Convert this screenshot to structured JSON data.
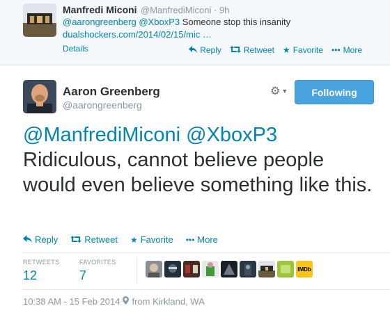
{
  "parent_tweet": {
    "name": "Manfredi Miconi",
    "handle": "@ManfrediMiconi",
    "separator": "·",
    "time": "9h",
    "mention1": "@aarongreenberg",
    "mention2": "@XboxP3",
    "text": "Someone stop this insanity",
    "link": "dualshockers.com/2014/02/15/mic",
    "ellipsis": "…",
    "details": "Details",
    "actions": {
      "reply": "Reply",
      "retweet": "Retweet",
      "favorite": "Favorite",
      "more": "More"
    }
  },
  "main_tweet": {
    "name": "Aaron Greenberg",
    "handle": "@aarongreenberg",
    "follow_label": "Following",
    "mention1": "@ManfrediMiconi",
    "mention2": "@XboxP3",
    "text": "Ridiculous, cannot believe people would even believe something like this.",
    "actions": {
      "reply": "Reply",
      "retweet": "Retweet",
      "favorite": "Favorite",
      "more": "More"
    },
    "stats": {
      "retweets_label": "RETWEETS",
      "retweets": "12",
      "favorites_label": "FAVORITES",
      "favorites": "7"
    },
    "timestamp": "10:38 AM - 15 Feb 2014",
    "location": "from Kirkland, WA",
    "imdb_badge": "IMDb"
  },
  "icons": {
    "reply": "reply-arrow-icon",
    "retweet": "retweet-icon",
    "favorite": "star-icon",
    "more": "dots-icon",
    "settings": "gear-icon",
    "location": "map-pin-icon"
  },
  "colors": {
    "link": "#0084b4",
    "button": "#4aa3df",
    "muted": "#8899a6",
    "text": "#292f33"
  }
}
